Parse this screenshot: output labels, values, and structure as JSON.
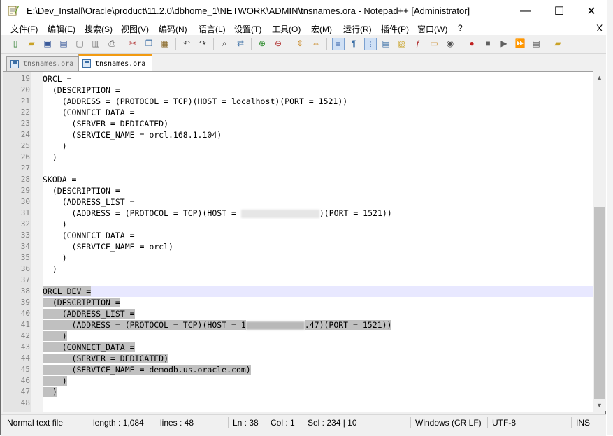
{
  "window": {
    "title": "E:\\Dev_Install\\Oracle\\product\\11.2.0\\dbhome_1\\NETWORK\\ADMIN\\tnsnames.ora - Notepad++ [Administrator]",
    "controls": {
      "minimize": "—",
      "maximize": "☐",
      "close": "✕"
    }
  },
  "menu": {
    "items": [
      "文件(F)",
      "编辑(E)",
      "搜索(S)",
      "视图(V)",
      "编码(N)",
      "语言(L)",
      "设置(T)",
      "工具(O)",
      "宏(M)",
      "运行(R)",
      "插件(P)",
      "窗口(W)",
      "?"
    ],
    "close_label": "X"
  },
  "toolbar": {
    "icons": [
      "new-file-icon",
      "open-file-icon",
      "save-icon",
      "save-all-icon",
      "close-icon",
      "close-all-icon",
      "print-icon",
      "cut-icon",
      "copy-icon",
      "paste-icon",
      "undo-icon",
      "redo-icon",
      "find-icon",
      "replace-icon",
      "zoom-in-icon",
      "zoom-out-icon",
      "sync-vertical-icon",
      "sync-horizontal-icon",
      "word-wrap-icon",
      "show-all-chars-icon",
      "indent-guide-icon",
      "doc-map-icon",
      "function-list-icon",
      "folder-workspace-icon",
      "monitor-icon",
      "record-macro-icon",
      "stop-record-icon",
      "play-macro-icon",
      "run-macro-multiple-icon",
      "save-macro-icon",
      "launch-icon"
    ]
  },
  "tabs": [
    {
      "label": "tnsnames.ora",
      "active": false
    },
    {
      "label": "tnsnames.ora",
      "active": true
    }
  ],
  "editor": {
    "lines": [
      {
        "n": "19",
        "text": "ORCL =",
        "state": "normal"
      },
      {
        "n": "20",
        "text": "  (DESCRIPTION =",
        "state": "normal"
      },
      {
        "n": "21",
        "text": "    (ADDRESS = (PROTOCOL = TCP)(HOST = localhost)(PORT = 1521))",
        "state": "normal"
      },
      {
        "n": "22",
        "text": "    (CONNECT_DATA =",
        "state": "normal"
      },
      {
        "n": "23",
        "text": "      (SERVER = DEDICATED)",
        "state": "normal"
      },
      {
        "n": "24",
        "text": "      (SERVICE_NAME = orcl.168.1.104)",
        "state": "normal"
      },
      {
        "n": "25",
        "text": "    )",
        "state": "normal"
      },
      {
        "n": "26",
        "text": "  )",
        "state": "normal"
      },
      {
        "n": "27",
        "text": "",
        "state": "normal"
      },
      {
        "n": "28",
        "text": "SKODA =",
        "state": "normal"
      },
      {
        "n": "29",
        "text": "  (DESCRIPTION =",
        "state": "normal"
      },
      {
        "n": "30",
        "text": "    (ADDRESS_LIST =",
        "state": "normal"
      },
      {
        "n": "31",
        "text": "      (ADDRESS = (PROTOCOL = TCP)(HOST = ",
        "blur_after": true,
        "text_after": ")(PORT = 1521))",
        "state": "normal"
      },
      {
        "n": "32",
        "text": "    )",
        "state": "normal"
      },
      {
        "n": "33",
        "text": "    (CONNECT_DATA =",
        "state": "normal"
      },
      {
        "n": "34",
        "text": "      (SERVICE_NAME = orcl)",
        "state": "normal"
      },
      {
        "n": "35",
        "text": "    )",
        "state": "normal"
      },
      {
        "n": "36",
        "text": "  )",
        "state": "normal"
      },
      {
        "n": "37",
        "text": "",
        "state": "normal"
      },
      {
        "n": "38",
        "text": "ORCL_DEV =",
        "state": "caret-sel"
      },
      {
        "n": "39",
        "text": "  (DESCRIPTION =",
        "state": "sel"
      },
      {
        "n": "40",
        "text": "    (ADDRESS_LIST =",
        "state": "sel"
      },
      {
        "n": "41",
        "text": "      (ADDRESS = (PROTOCOL = TCP)(HOST = 1",
        "blur_after": true,
        "text_after": ".47)(PORT = 1521))",
        "state": "sel"
      },
      {
        "n": "42",
        "text": "    )",
        "state": "sel"
      },
      {
        "n": "43",
        "text": "    (CONNECT_DATA =",
        "state": "sel"
      },
      {
        "n": "44",
        "text": "      (SERVER = DEDICATED)",
        "state": "sel"
      },
      {
        "n": "45",
        "text": "      (SERVICE_NAME = demodb.us.oracle.com)",
        "state": "sel"
      },
      {
        "n": "46",
        "text": "    )",
        "state": "sel"
      },
      {
        "n": "47",
        "text": "  )",
        "state": "sel"
      },
      {
        "n": "48",
        "text": "",
        "state": "normal"
      }
    ]
  },
  "status": {
    "file_type": "Normal text file",
    "length": "length : 1,084",
    "lines": "lines : 48",
    "ln": "Ln : 38",
    "col": "Col : 1",
    "sel": "Sel : 234 | 10",
    "eol": "Windows (CR LF)",
    "encoding": "UTF-8",
    "mode": "INS"
  },
  "colors": {
    "selection": "#c0c0c0",
    "caret_line": "#e8e8ff",
    "active_tab_accent": "#f29b12"
  }
}
